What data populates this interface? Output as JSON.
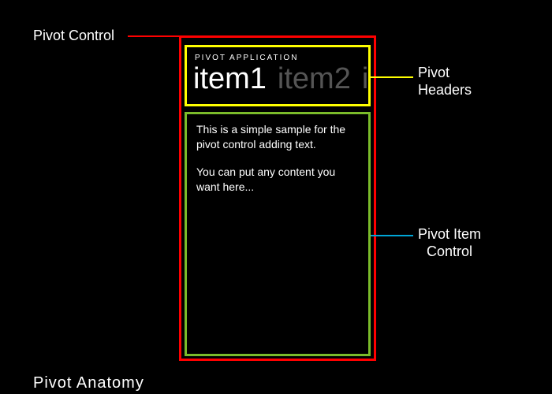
{
  "diagram": {
    "caption": "Pivot  Anatomy",
    "app_title": "PIVOT APPLICATION",
    "pivot_headers": [
      {
        "label": "item1",
        "active": true
      },
      {
        "label": "item2",
        "active": false
      },
      {
        "label": "ite",
        "active": false
      }
    ],
    "content_para1": "This is a simple sample for the pivot control adding text.",
    "content_para2": "You can put any content you want here...",
    "labels": {
      "pivot_control": "Pivot Control",
      "pivot_headers": "Pivot Headers",
      "pivot_item_control": "Pivot Item Control"
    },
    "colors": {
      "pivot_control_border": "#ff0000",
      "pivot_headers_border": "#ffff00",
      "pivot_content_border": "#7bbb2a",
      "connector_item": "#00a5d6"
    }
  }
}
